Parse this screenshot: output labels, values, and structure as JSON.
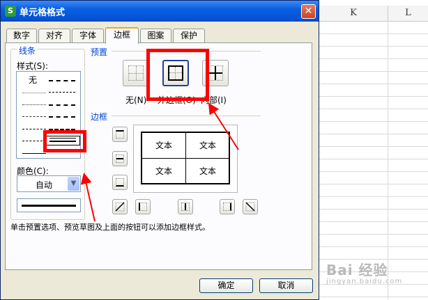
{
  "dialog": {
    "title": "单元格格式",
    "app_icon": "S"
  },
  "tabs": [
    {
      "label": "数字"
    },
    {
      "label": "对齐"
    },
    {
      "label": "字体"
    },
    {
      "label": "边框",
      "active": true
    },
    {
      "label": "图案"
    },
    {
      "label": "保护"
    }
  ],
  "line_group": {
    "title": "线条",
    "style_label": "样式(S):",
    "style_none": "无",
    "color_label": "颜色(C):",
    "color_value": "自动"
  },
  "presets": {
    "title": "预置",
    "items": [
      {
        "label": "无(N)",
        "icon": "border-none-icon"
      },
      {
        "label": "外边框(O)",
        "icon": "border-outline-icon"
      },
      {
        "label": "内部(I)",
        "icon": "border-inside-icon"
      }
    ]
  },
  "border": {
    "title": "边框",
    "cells": [
      "文本",
      "文本",
      "文本",
      "文本"
    ]
  },
  "note": "单击预置选项、预览草图及上面的按钮可以添加边框样式。",
  "buttons": {
    "ok": "确定",
    "cancel": "取消"
  },
  "sheet": {
    "columns": [
      "K",
      "L"
    ]
  },
  "watermark": {
    "brand": "Bai 经验",
    "url": "jingyan.baidu.com"
  },
  "colors": {
    "annotation": "#ff0000",
    "title_bar": "#0553d8",
    "group_title": "#0046d5"
  }
}
